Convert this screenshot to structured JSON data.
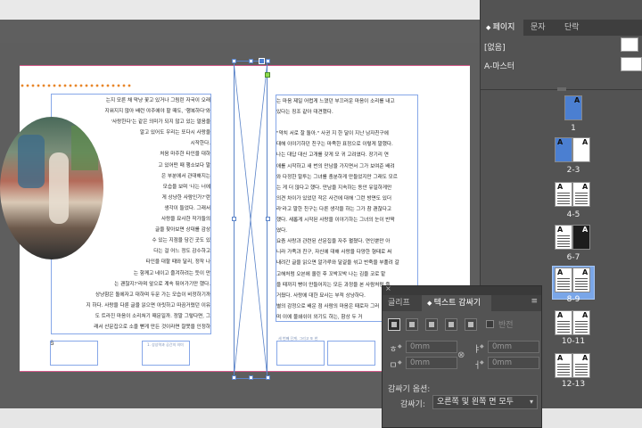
{
  "panel": {
    "tabs": [
      "페이지",
      "문자",
      "단락"
    ],
    "none_label": "[없음]",
    "master_label": "A-마스터",
    "thumbs": [
      {
        "letter": "A"
      },
      {
        "letter": "A"
      },
      {
        "letter": "A"
      }
    ],
    "spread_labels": [
      "1",
      "2-3",
      "4-5",
      "6-7",
      "8-9",
      "10-11",
      "12-13"
    ]
  },
  "document": {
    "left_page_number": "8",
    "footer_left": "1. 상상력과 공간의 의미",
    "footer_right": "세 번째 단계. 그리고 또 한",
    "left_text": [
      "는지 모른 채 막냥 꽃고 있거나 그림린 자국이 오래",
      "지워지지 않아 배런 야주에야 할 때도, '행복하다'와",
      "'사랑한다'는 같은 의미가 되지 않고 있는 얼음을",
      "알고 있어도 우리는 또다시 사랑을",
      "시작한다.",
      "처음 마주한 타인을 대하",
      "고 있어떤 때 행소보다 말",
      "은 부분에서 관대해지는",
      "모습을 보며 '나는 너에",
      "게 상냥한 사람인가?'란",
      "생각이 들었다. 그래서",
      "사랑을 묘사한 작가들의",
      "글을 찾아보면 상대를 감상",
      "수 있는 지점을 담긴 곳도 있",
      "다는 걸 어느 정도 감수하고",
      "타인을 대할 때와 달리, 정작 나",
      "는 함께고 네이고 즐겨하려는 듯이 만",
      "는 괜찮지?'라며 앞으로 계속 뛰어가기만 했다.",
      "상냥함은 돌에자고 대하며 두문 가는 모습이 비정하기까",
      "지 하다. 사랑을 다룬 글을 읽으면 아릿하고 따끔거렸던 이유",
      "도 트라진 마음이 소리쳐기 때문일까. 정말 그렇다면, 그",
      "래서 산문집으로 소을 뻗게 만든 것이라면 잘못을 인정하"
    ],
    "right_text": [
      "는 마음 제일 어렵게 느꼈던 부끄러운 마음이 소리를 내고",
      "있다는 징조 같아 대견했다.",
      "",
      "\"약치 서로 잘 돌아.\" 사귄 지 한 달이 지난 남자친구에",
      "대해 이야기하던 친구는 마족한 표정으로 이렇게 말했다.",
      "나는 대답 대신 고개를 갖게 모 귀 고려였다. 장기리 연",
      "애를 시작하고 새 번의 만남을 가지면서 그가 보여준 배려",
      "와 다정한 말투는 그녀를 충분하게 만들었지만 그래도 모르",
      "는 게 더 많다고 했다. 만남을 지속하는 동안 유일하게만",
      "의견 차이가 있었던 작은 사건에 대해 '그런 방면도 있더",
      "라'라고 말한 친구는 다른 생각을 하는 그가 참 괜찮다고",
      "했다. 새롭게 시작된 사랑을 이야기하는 그녀의 눈이 반짝",
      "였다.",
      "요즘 사랑과 관련된 산문집을 자주 펼쳤다. 연인뿐만 아",
      "니라 가족과 친구, 자신에 대해 사랑을 다양한 형태로 써",
      "내려간 글을 읽으면 알가루와 달걀을 섞고 반죽을 부풀려 갈",
      "고해처럼 오븐에 올린 후 꼬박꼬박 나는 김을 코로 맡",
      "을 때까지 빵이 만들어지는 모든 과정을 본 사람처럼 즐",
      "거웠다. 사랑에 대한 묘사는 부적 상냥하다.",
      "별의 감정으로 배운 점 사람의 마음은 때로자 그러",
      "며 이에 물쇄쉬이 외기도 하는, 함상 두 거"
    ]
  },
  "text_wrap_panel": {
    "tab_glyph": "글리프",
    "tab_wrap": "텍스트 감싸기",
    "menu_glyph": "≡",
    "invert_label": "반전",
    "offset_top": "0mm",
    "offset_bottom": "0mm",
    "offset_left": "0mm",
    "offset_right": "0mm",
    "offset_icons": [
      "ㅎ",
      "ㅁ",
      "ㅑ",
      "ㅓ"
    ],
    "wrap_options_label": "감싸기 옵션:",
    "wrap_to_label": "감싸기:",
    "wrap_to_value": "오른쪽 및 왼쪽 면 모두"
  },
  "colors": {
    "accent_orange": "#e88628",
    "guide_blue": "#86a7e8",
    "margin_pink": "#d55a8a",
    "selected_spread": "#7aa6e8"
  }
}
